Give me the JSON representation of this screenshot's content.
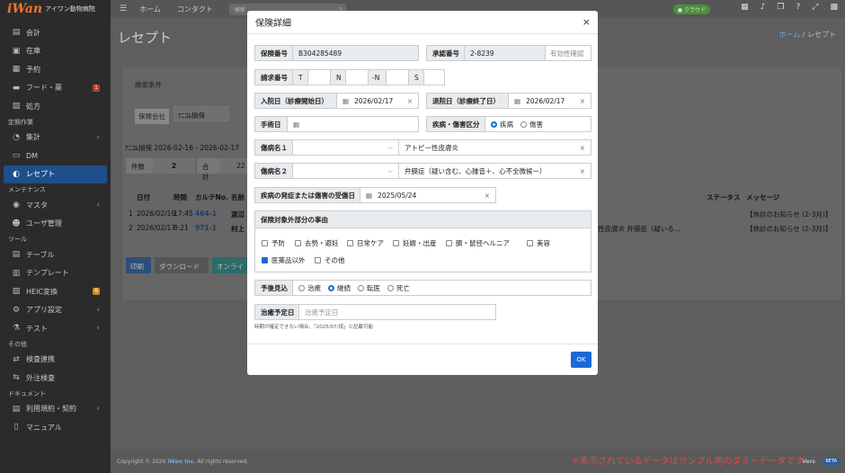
{
  "brand": {
    "name": "アイワン動物病院"
  },
  "sidebar": {
    "items": [
      {
        "label": "会計",
        "icon": "register-icon"
      },
      {
        "label": "在庫",
        "icon": "box-icon"
      },
      {
        "label": "予約",
        "icon": "calendar-icon"
      },
      {
        "label": "フード・薬",
        "icon": "folder-icon",
        "badge": "1"
      },
      {
        "label": "処方",
        "icon": "pill-icon"
      }
    ],
    "sec1": "定期作業",
    "items2": [
      {
        "label": "集計",
        "icon": "chart-icon"
      },
      {
        "label": "DM",
        "icon": "mail-icon"
      },
      {
        "label": "レセプト",
        "icon": "receipt-icon"
      }
    ],
    "sec2": "メンテナンス",
    "items3": [
      {
        "label": "マスタ",
        "icon": "database-icon"
      },
      {
        "label": "ユーザ管理",
        "icon": "users-icon"
      }
    ],
    "sec3": "ツール",
    "items4": [
      {
        "label": "テーブル",
        "icon": "table-icon"
      },
      {
        "label": "テンプレート",
        "icon": "template-icon"
      },
      {
        "label": "HEIC変換",
        "icon": "image-icon",
        "badge": "6"
      },
      {
        "label": "アプリ設定",
        "icon": "gear-icon"
      },
      {
        "label": "テスト",
        "icon": "flask-icon"
      }
    ],
    "sec4": "その他",
    "items5": [
      {
        "label": "検査連携",
        "icon": "link-icon"
      },
      {
        "label": "外注検査",
        "icon": "share-icon"
      }
    ],
    "sec5": "ドキュメント",
    "items6": [
      {
        "label": "利用規約・契約",
        "icon": "book-icon"
      },
      {
        "label": "マニュアル",
        "icon": "file-icon"
      }
    ]
  },
  "topbar": {
    "home": "ホーム",
    "contact": "コンタクト",
    "search_placeholder": "検索",
    "cloud": "● クラウド"
  },
  "page": {
    "title": "レセプト",
    "bc_home": "ホーム",
    "bc_sep": "/",
    "bc_current": "レセプト"
  },
  "bg": {
    "filter_title": "検索条件",
    "insurer_label": "保険会社",
    "insurer_value": "ｱﾆｺﾑ損保",
    "period": "ｱﾆｺﾑ損保 2026-02-16 - 2026-02-17",
    "count_label": "件数",
    "count_value": "2",
    "total_label": "合計",
    "total_value": "22",
    "headers": [
      "日付",
      "時間",
      "カルテNo.",
      "名前",
      "ステータス",
      "メッセージ"
    ],
    "rows": [
      {
        "n": "1",
        "date": "2026/02/16",
        "time": "17:45",
        "karte": "464-1",
        "name": "渡辺",
        "msg": "【休診のお知らせ (2-3月)】"
      },
      {
        "n": "2",
        "date": "2026/02/17",
        "time": "8:21",
        "karte": "971-1",
        "name": "村上",
        "diag": "性皮膚炎 弁膜症（疑いる...",
        "msg": "【休診のお知らせ (2-3月)】"
      }
    ],
    "btn_print": "印刷",
    "btn_download": "ダウンロード",
    "btn_online": "オンライ"
  },
  "modal": {
    "title": "保険詳細",
    "policy_label": "保険番号",
    "policy_value": "B304285489",
    "approval_label": "承認番号",
    "approval_value": "2-8239",
    "verify": "有効性確認",
    "claim_label": "請求番号",
    "claim_parts": [
      "T",
      "N",
      "-N",
      "S"
    ],
    "admit_label": "入院日（診療開始日）",
    "admit_value": "2026/02/17",
    "discharge_label": "退院日（診療終了日）",
    "discharge_value": "2026/02/17",
    "surgery_label": "手術日",
    "kind_label": "疾病・傷害区分",
    "kind_opts": [
      "疾病",
      "傷害"
    ],
    "diag1_label": "傷病名１",
    "diag1_value": "アトピー性皮膚炎",
    "diag2_label": "傷病名２",
    "diag2_value": "弁膜症（疑い含む、心雑音＋、心不全微候ー）",
    "onset_label": "疾病の発症または傷害の受傷日",
    "onset_value": "2025/05/24",
    "reason_title": "保険対象外部分の事由",
    "reasons": [
      "予防",
      "去勢・避妊",
      "日常ケア",
      "妊娠・出産",
      "臍・鼠径ヘルニア",
      "美容",
      "医薬品以外",
      "その他"
    ],
    "prog_label": "予後見込",
    "prog_opts": [
      "治癒",
      "継続",
      "転医",
      "死亡"
    ],
    "cure_label": "治癒予定日",
    "cure_placeholder": "治癒予定日",
    "note": "時期が確定できない場合、「2025/07/頃」と記載可能",
    "ok": "OK",
    "close": "×"
  },
  "footer": {
    "copyright": "Copyright © 2026",
    "company": "iWan Inc.",
    "rights": "All rights reserved.",
    "version": "Vers"
  },
  "notice": "＊表示されているデータはサンプル用のダミーデータです",
  "beta": "BETA"
}
